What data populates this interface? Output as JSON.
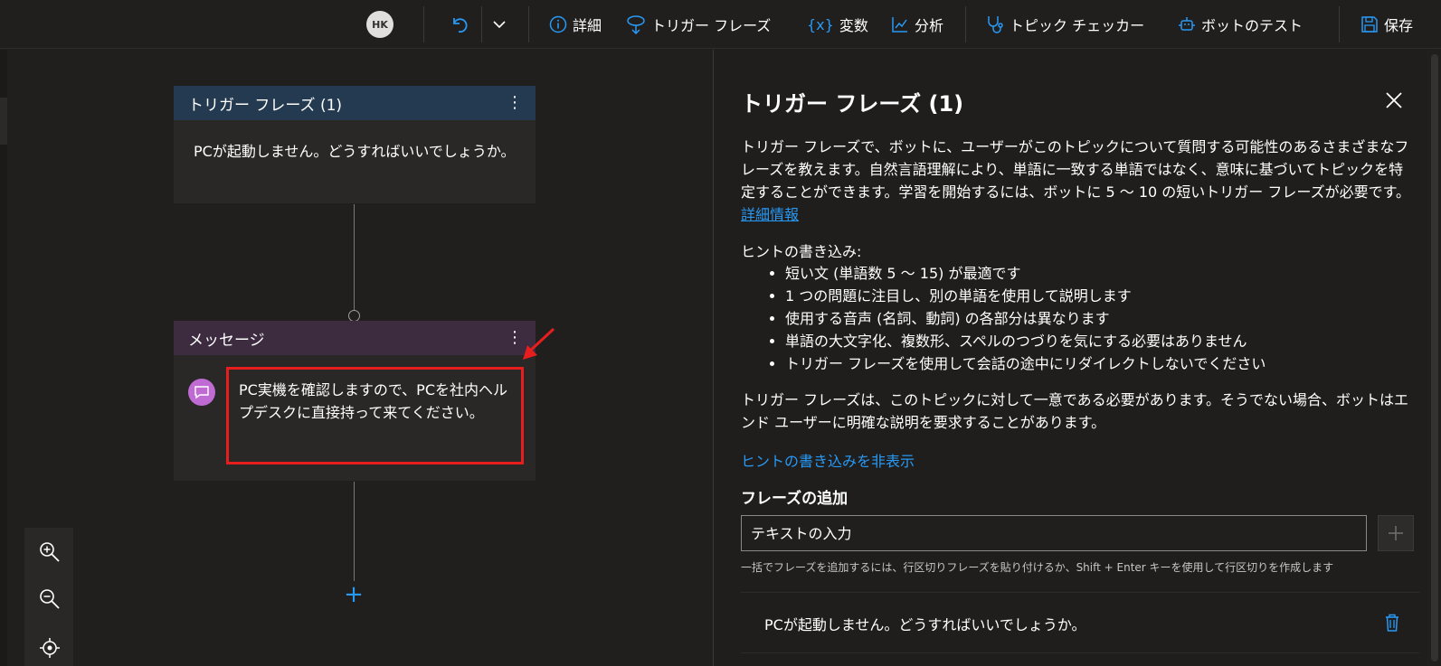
{
  "toolbar": {
    "avatar_initials": "HK",
    "details": "詳細",
    "trigger_phrases": "トリガー フレーズ",
    "variables_icon": "{x}",
    "variables": "変数",
    "analytics": "分析",
    "topic_checker": "トピック チェッカー",
    "test_bot": "ボットのテスト",
    "save": "保存"
  },
  "canvas": {
    "trigger_node": {
      "title": "トリガー フレーズ (1)",
      "text": "PCが起動しません。どうすればいいでしょうか。"
    },
    "message_node": {
      "title": "メッセージ",
      "text": "PC実機を確認しますので、PCを社内ヘルプデスクに直接持って来てください。"
    }
  },
  "panel": {
    "title": "トリガー フレーズ (1)",
    "description": "トリガー フレーズで、ボットに、ユーザーがこのトピックについて質問する可能性のあるさまざまなフレーズを教えます。自然言語理解により、単語に一致する単語ではなく、意味に基づいてトピックを特定することができます。学習を開始するには、ボットに 5 〜 10 の短いトリガー フレーズが必要です。",
    "learn_more": "詳細情報",
    "hints_title": "ヒントの書き込み:",
    "hints": [
      "短い文 (単語数 5 〜 15) が最適です",
      "1 つの問題に注目し、別の単語を使用して説明します",
      "使用する音声 (名詞、動詞) の各部分は異なります",
      "単語の大文字化、複数形、スペルのつづりを気にする必要はありません",
      "トリガー フレーズを使用して会話の途中にリダイレクトしないでください"
    ],
    "uniqueness_note": "トリガー フレーズは、このトピックに対して一意である必要があります。そうでない場合、ボットはエンド ユーザーに明確な説明を要求することがあります。",
    "hide_hints": "ヒントの書き込みを非表示",
    "add_phrases_title": "フレーズの追加",
    "input_placeholder": "テキストの入力",
    "helper_text": "一括でフレーズを追加するには、行区切りフレーズを貼り付けるか、Shift + Enter キーを使用して行区切りを作成します",
    "phrases": [
      "PCが起動しません。どうすればいいでしょうか。"
    ]
  },
  "colors": {
    "accent": "#2899f5",
    "trigger_header": "#243a51",
    "message_header": "#3d2b40",
    "highlight": "#e81e1e",
    "message_icon": "#c06bd4"
  }
}
